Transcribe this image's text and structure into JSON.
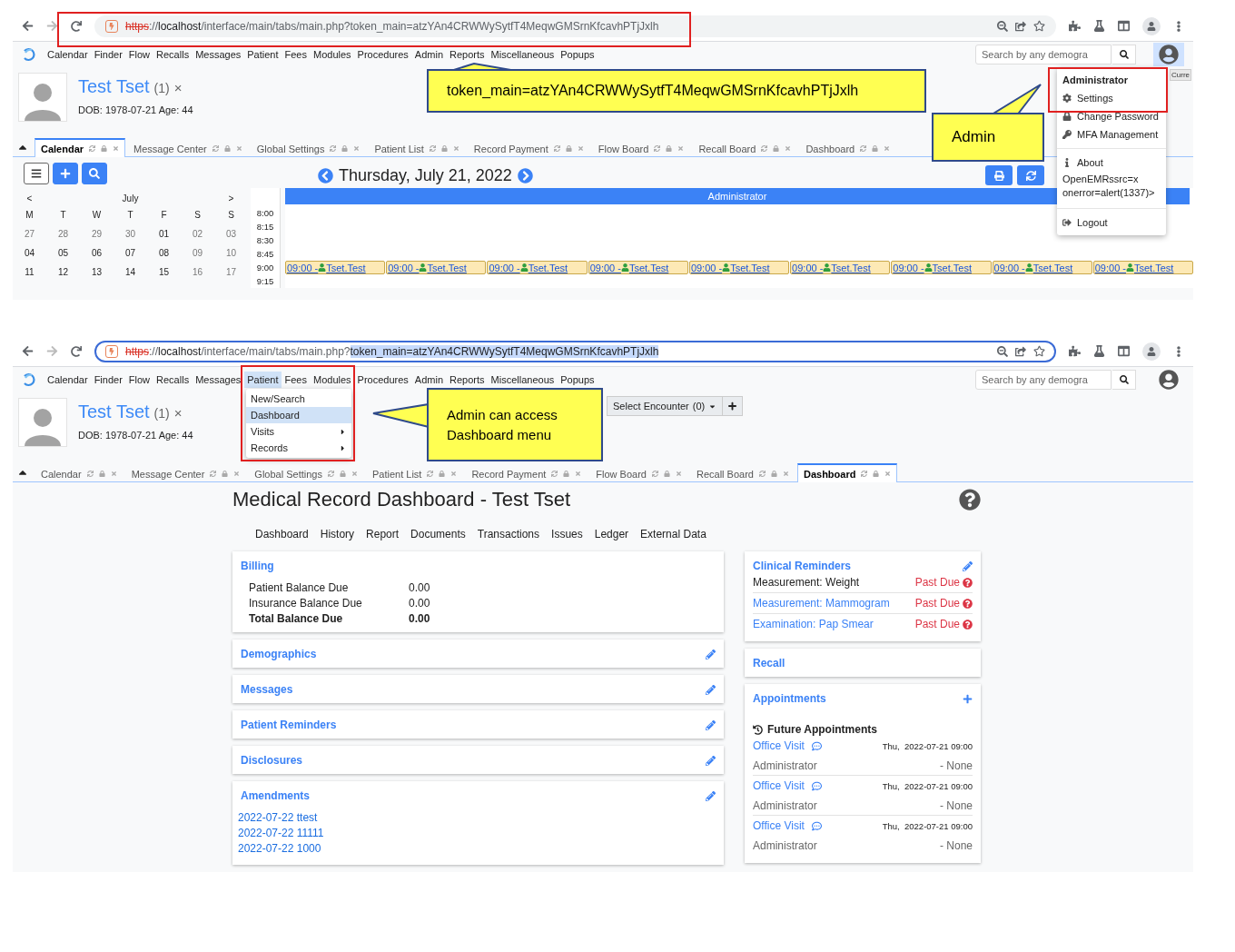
{
  "top_screenshot": {
    "browser": {
      "focused": false,
      "url": [
        {
          "kind": "scheme",
          "text": "https"
        },
        {
          "kind": "separator",
          "text": "://"
        },
        {
          "kind": "host",
          "text": "localhost"
        },
        {
          "kind": "path",
          "text": "/interface/main/tabs/main.php?token_main=atzYAn4CRWWySytfT4MeqwGMSrnKfcavhPTjJxlh"
        }
      ]
    },
    "menu": [
      {
        "label": "Calendar",
        "selected": false
      },
      {
        "label": "Finder",
        "selected": false
      },
      {
        "label": "Flow",
        "selected": false
      },
      {
        "label": "Recalls",
        "selected": false
      },
      {
        "label": "Messages",
        "selected": false
      },
      {
        "label": "Patient",
        "selected": false
      },
      {
        "label": "Fees",
        "selected": false
      },
      {
        "label": "Modules",
        "selected": false
      },
      {
        "label": "Procedures",
        "selected": false
      },
      {
        "label": "Admin",
        "selected": false
      },
      {
        "label": "Reports",
        "selected": false
      },
      {
        "label": "Miscellaneous",
        "selected": false
      },
      {
        "label": "Popups",
        "selected": false
      }
    ],
    "search": {
      "placeholder": "Search by any demogra"
    },
    "account_button": {
      "selected": true
    },
    "patient": {
      "name": "Test Tset",
      "count": "(1)",
      "close": "×",
      "dob": "DOB: 1978-07-21 Age: 44"
    },
    "tabs": [
      {
        "label": "Calendar",
        "selected": true
      },
      {
        "label": "Message Center",
        "selected": false
      },
      {
        "label": "Global Settings",
        "selected": false
      },
      {
        "label": "Patient List",
        "selected": false
      },
      {
        "label": "Record Payment",
        "selected": false
      },
      {
        "label": "Flow Board",
        "selected": false
      },
      {
        "label": "Recall Board",
        "selected": false
      },
      {
        "label": "Dashboard",
        "selected": false
      }
    ],
    "mini_calendar": {
      "prev": "<",
      "month": "July",
      "next": ">",
      "weekdays": [
        "M",
        "T",
        "W",
        "T",
        "F",
        "S",
        "S"
      ],
      "weeks": [
        [
          {
            "day": "27",
            "muted": true
          },
          {
            "day": "28",
            "muted": true
          },
          {
            "day": "29",
            "muted": true
          },
          {
            "day": "30",
            "muted": true
          },
          {
            "day": "01",
            "muted": false
          },
          {
            "day": "02",
            "muted": true
          },
          {
            "day": "03",
            "muted": true
          }
        ],
        [
          {
            "day": "04",
            "muted": false
          },
          {
            "day": "05",
            "muted": false
          },
          {
            "day": "06",
            "muted": false
          },
          {
            "day": "07",
            "muted": false
          },
          {
            "day": "08",
            "muted": false
          },
          {
            "day": "09",
            "muted": true
          },
          {
            "day": "10",
            "muted": true
          }
        ],
        [
          {
            "day": "11",
            "muted": false
          },
          {
            "day": "12",
            "muted": false
          },
          {
            "day": "13",
            "muted": false
          },
          {
            "day": "14",
            "muted": false
          },
          {
            "day": "15",
            "muted": false
          },
          {
            "day": "16",
            "muted": true
          },
          {
            "day": "17",
            "muted": true
          }
        ]
      ]
    },
    "date_title": "Thursday, July 21, 2022",
    "provider": "Administrator",
    "slots": [
      {
        "time": "8:00"
      },
      {
        "time": "8:15"
      },
      {
        "time": "8:30"
      },
      {
        "time": "8:45"
      },
      {
        "time": "9:00",
        "appointments": [
          {
            "time": "09:00 -",
            "patient": "Tset.Test"
          },
          {
            "time": "09:00 -",
            "patient": "Tset.Test"
          },
          {
            "time": "09:00 -",
            "patient": "Tset.Test"
          },
          {
            "time": "09:00 -",
            "patient": "Tset.Test"
          },
          {
            "time": "09:00 -",
            "patient": "Tset.Test"
          },
          {
            "time": "09:00 -",
            "patient": "Tset.Test"
          },
          {
            "time": "09:00 -",
            "patient": "Tset.Test"
          },
          {
            "time": "09:00 -",
            "patient": "Tset.Test"
          },
          {
            "time": "09:00 -",
            "patient": "Tset.Test"
          }
        ]
      },
      {
        "time": "9:15"
      }
    ],
    "user_menu": {
      "title": "Administrator",
      "groups": [
        [
          {
            "kind": "item",
            "label": "Settings"
          },
          {
            "kind": "item",
            "label": "Change Password"
          },
          {
            "kind": "item",
            "label": "MFA Management"
          }
        ],
        [
          {
            "kind": "item",
            "label": "About"
          },
          {
            "kind": "text",
            "label": "OpenEMRssrc=x onerror=alert(1337)>"
          }
        ],
        [
          {
            "kind": "item",
            "label": "Logout"
          }
        ]
      ]
    },
    "tooltip": "Curre",
    "annotations": [
      "token_main=atzYAn4CRWWySytfT4MeqwGMSrnKfcavhPTjJxlh",
      "Admin"
    ]
  },
  "bottom_screenshot": {
    "browser": {
      "focused": true,
      "url": [
        {
          "kind": "scheme",
          "text": "https"
        },
        {
          "kind": "separator",
          "text": "://"
        },
        {
          "kind": "host",
          "text": "localhost"
        },
        {
          "kind": "path",
          "text": "/interface/main/tabs/main.php?"
        },
        {
          "kind": "query",
          "text": "token_main=atzYAn4CRWWySytfT4MeqwGMSrnKfcavhPTjJxlh",
          "selected": true
        }
      ]
    },
    "menu": [
      {
        "label": "Calendar",
        "selected": false
      },
      {
        "label": "Finder",
        "selected": false
      },
      {
        "label": "Flow",
        "selected": false
      },
      {
        "label": "Recalls",
        "selected": false
      },
      {
        "label": "Messages",
        "selected": false
      },
      {
        "label": "Patient",
        "selected": true
      },
      {
        "label": "Fees",
        "selected": false
      },
      {
        "label": "Modules",
        "selected": false
      },
      {
        "label": "Procedures",
        "selected": false
      },
      {
        "label": "Admin",
        "selected": false
      },
      {
        "label": "Reports",
        "selected": false
      },
      {
        "label": "Miscellaneous",
        "selected": false
      },
      {
        "label": "Popups",
        "selected": false
      }
    ],
    "search": {
      "placeholder": "Search by any demogra"
    },
    "account_button": {
      "selected": false
    },
    "patient_menu": [
      {
        "label": "New/Search",
        "selected": false,
        "submenu": false
      },
      {
        "label": "Dashboard",
        "selected": true,
        "submenu": false
      },
      {
        "label": "Visits",
        "selected": false,
        "submenu": true
      },
      {
        "label": "Records",
        "selected": false,
        "submenu": true
      }
    ],
    "patient": {
      "name": "Test Tset",
      "count": "(1)",
      "close": "×",
      "dob": "DOB: 1978-07-21 Age: 44"
    },
    "encounter": {
      "label": "Select Encounter",
      "count": "(0)"
    },
    "tabs": [
      {
        "label": "Calendar",
        "selected": false
      },
      {
        "label": "Message Center",
        "selected": false
      },
      {
        "label": "Global Settings",
        "selected": false
      },
      {
        "label": "Patient List",
        "selected": false
      },
      {
        "label": "Record Payment",
        "selected": false
      },
      {
        "label": "Flow Board",
        "selected": false
      },
      {
        "label": "Recall Board",
        "selected": false
      },
      {
        "label": "Dashboard",
        "selected": true
      }
    ],
    "dashboard": {
      "title": "Medical Record Dashboard - Test Tset",
      "nav": [
        "Dashboard",
        "History",
        "Report",
        "Documents",
        "Transactions",
        "Issues",
        "Ledger",
        "External Data"
      ],
      "billing": {
        "title": "Billing",
        "rows": [
          {
            "label": "Patient Balance Due",
            "value": "0.00",
            "total": false
          },
          {
            "label": "Insurance Balance Due",
            "value": "0.00",
            "total": false
          },
          {
            "label": "Total Balance Due",
            "value": "0.00",
            "total": true
          }
        ]
      },
      "cards": [
        "Demographics",
        "Messages",
        "Patient Reminders",
        "Disclosures"
      ],
      "amendments": {
        "title": "Amendments",
        "links": [
          "2022-07-22 ttest",
          "2022-07-22 11111",
          "2022-07-22 1000"
        ]
      },
      "clinical_reminders": {
        "title": "Clinical Reminders",
        "items": [
          {
            "label": "Measurement: Weight",
            "status": "Past Due",
            "link": false
          },
          {
            "label": "Measurement: Mammogram",
            "status": "Past Due",
            "link": true
          },
          {
            "label": "Examination: Pap Smear",
            "status": "Past Due",
            "link": true
          }
        ]
      },
      "recall": {
        "title": "Recall"
      },
      "appointments": {
        "title": "Appointments",
        "section": "Future Appointments",
        "items": [
          {
            "type": "Office Visit",
            "date": "Thu,  2022-07-21 09:00",
            "provider": "Administrator",
            "status": "- None"
          },
          {
            "type": "Office Visit",
            "date": "Thu,  2022-07-21 09:00",
            "provider": "Administrator",
            "status": "- None"
          },
          {
            "type": "Office Visit",
            "date": "Thu,  2022-07-21 09:00",
            "provider": "Administrator",
            "status": "- None"
          }
        ]
      }
    },
    "annotations": [
      "Admin can access Dashboard menu"
    ]
  }
}
